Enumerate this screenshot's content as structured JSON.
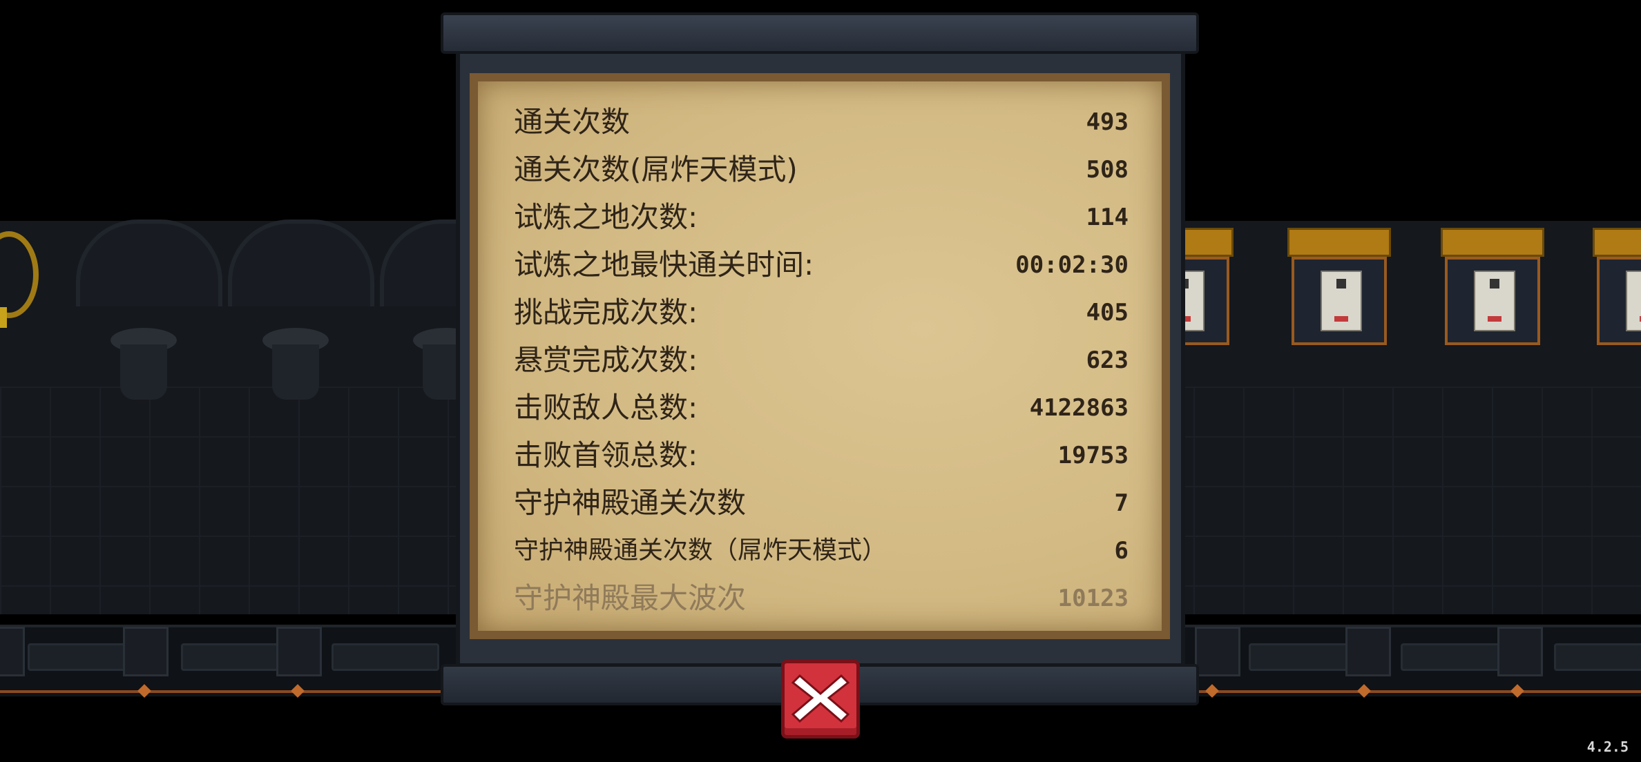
{
  "stats": [
    {
      "label": "通关次数",
      "value": "493"
    },
    {
      "label": "通关次数(屌炸天模式)",
      "value": "508"
    },
    {
      "label": "试炼之地次数:",
      "value": "114"
    },
    {
      "label": "试炼之地最快通关时间:",
      "value": "00:02:30"
    },
    {
      "label": "挑战完成次数:",
      "value": "405"
    },
    {
      "label": "悬赏完成次数:",
      "value": "623"
    },
    {
      "label": "击败敌人总数:",
      "value": "4122863"
    },
    {
      "label": "击败首领总数:",
      "value": "19753"
    },
    {
      "label": "守护神殿通关次数",
      "value": "7"
    },
    {
      "label": "守护神殿通关次数（屌炸天模式）",
      "value": "6"
    },
    {
      "label": "守护神殿最大波次",
      "value": "10123"
    }
  ],
  "close_button": {
    "icon": "close-icon",
    "color": "#d2323c"
  },
  "version": "4.2.5",
  "colors": {
    "parchment": "#d3ba84",
    "text": "#2f2418",
    "panel": "#2b313b"
  }
}
